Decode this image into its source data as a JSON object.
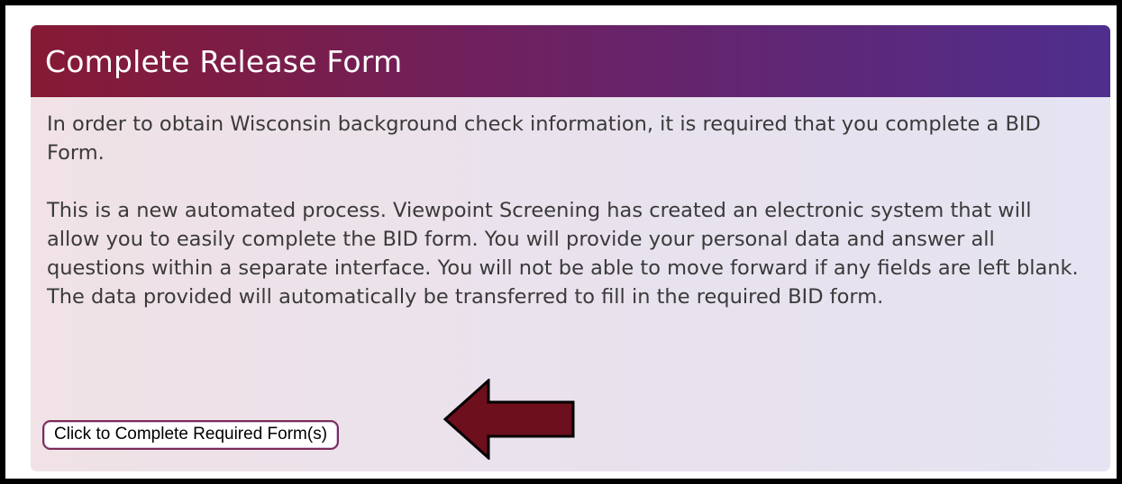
{
  "panel": {
    "title": "Complete Release Form",
    "paragraphs": [
      "In order to obtain Wisconsin background check information, it is required that you complete a BID Form.",
      "This is a new automated process. Viewpoint Screening has created an electronic system that will allow you to easily complete the BID form. You will provide your personal data and answer all questions within a separate interface. You will not be able to move forward if any fields are left blank. The data provided will automatically be transferred to fill in the required BID form."
    ],
    "button_label": "Click to Complete Required Form(s)"
  },
  "annotation": {
    "icon": "left-arrow-icon",
    "color": "#6d0f1c"
  },
  "colors": {
    "header_start": "#861a34",
    "header_end": "#4f2e8e",
    "text": "#3a3a3a"
  }
}
